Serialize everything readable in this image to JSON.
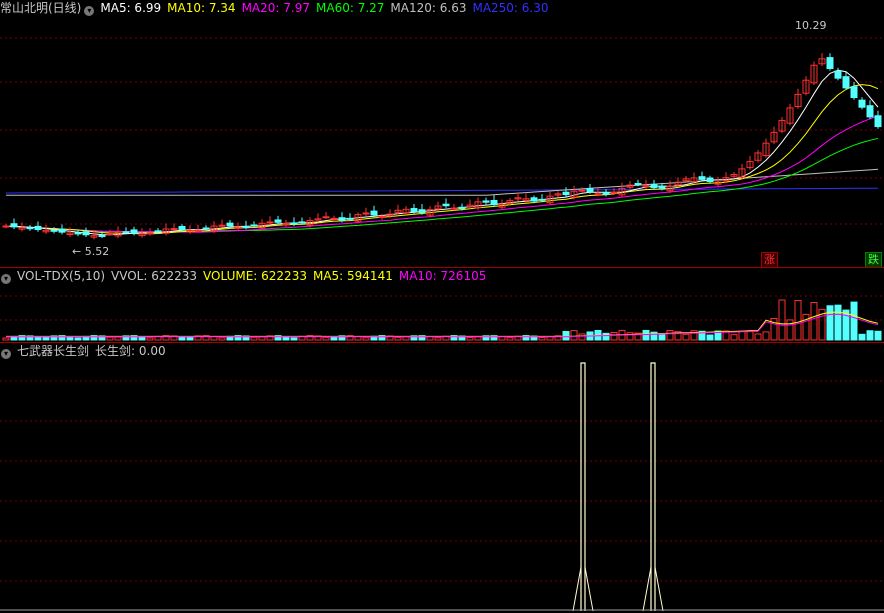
{
  "main": {
    "title": "常山北明(日线)",
    "ma": [
      {
        "label": "MA5: 6.99",
        "color": "#ffffff"
      },
      {
        "label": "MA10: 7.34",
        "color": "#ffff00"
      },
      {
        "label": "MA20: 7.97",
        "color": "#ff00ff"
      },
      {
        "label": "MA60: 7.27",
        "color": "#00ff00"
      },
      {
        "label": "MA120: 6.63",
        "color": "#c0c0c0"
      },
      {
        "label": "MA250: 6.30",
        "color": "#3030ff"
      }
    ],
    "high_label": "10.29",
    "low_label": "← 5.52",
    "rise_badge": "涨",
    "fall_badge": "跌"
  },
  "volume": {
    "title": "VOL-TDX(5,10)",
    "items": [
      {
        "label": "VVOL: 622233",
        "color": "#c8c8c8"
      },
      {
        "label": "VOLUME: 622233",
        "color": "#ffff00"
      },
      {
        "label": "MA5: 594141",
        "color": "#ffff00"
      },
      {
        "label": "MA10: 726105",
        "color": "#ff00ff"
      }
    ]
  },
  "indicator": {
    "title": "七武器长生剑",
    "items": [
      {
        "label": "长生剑: 0.00",
        "color": "#c8c8c8"
      }
    ]
  },
  "colors": {
    "up": "#ff3030",
    "down": "#54ffff",
    "grid": "#7a0000",
    "separator": "#a00000"
  }
}
